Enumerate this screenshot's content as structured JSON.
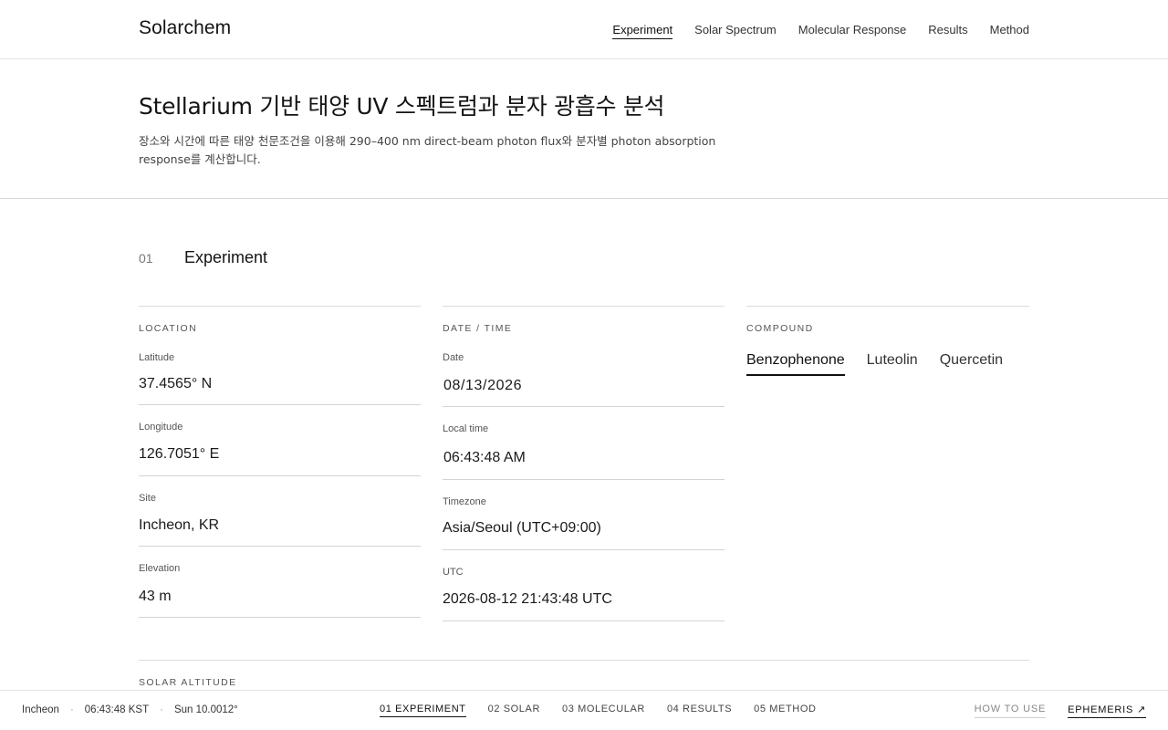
{
  "brand": "Solarchem",
  "nav": [
    "Experiment",
    "Solar Spectrum",
    "Molecular Response",
    "Results",
    "Method"
  ],
  "hero": {
    "title": "Stellarium 기반 태양 UV 스펙트럼과 분자 광흡수 분석",
    "description": "장소와 시간에 따른 태양 천문조건을 이용해 290–400 nm direct-beam photon flux와 분자별 photon absorption response를 계산합니다."
  },
  "section": {
    "number": "01",
    "title": "Experiment"
  },
  "location": {
    "label": "LOCATION",
    "latitude_label": "Latitude",
    "latitude": "37.4565° N",
    "longitude_label": "Longitude",
    "longitude": "126.7051° E",
    "site_label": "Site",
    "site": "Incheon, KR",
    "elevation_label": "Elevation",
    "elevation": "43 m"
  },
  "datetime": {
    "label": "DATE / TIME",
    "date_label": "Date",
    "date": "08/13/2026",
    "time_label": "Local time",
    "time": "06:43:48 AM",
    "tz_label": "Timezone",
    "tz": "Asia/Seoul (UTC+09:00)",
    "utc_label": "UTC",
    "utc": "2026-08-12 21:43:48 UTC"
  },
  "compound": {
    "label": "COMPOUND",
    "options": [
      "Benzophenone",
      "Luteolin",
      "Quercetin"
    ],
    "selected": "Benzophenone"
  },
  "solar_altitude": {
    "label": "SOLAR ALTITUDE"
  },
  "status": {
    "site": "Incheon",
    "time": "06:43:48 KST",
    "sun": "Sun 10.0012°",
    "sep": "·"
  },
  "bottom_nav": [
    "01 EXPERIMENT",
    "02 SOLAR",
    "03 MOLECULAR",
    "04 RESULTS",
    "05 METHOD"
  ],
  "how_to_use": "HOW TO USE",
  "ephemeris": "EPHEMERIS ↗"
}
